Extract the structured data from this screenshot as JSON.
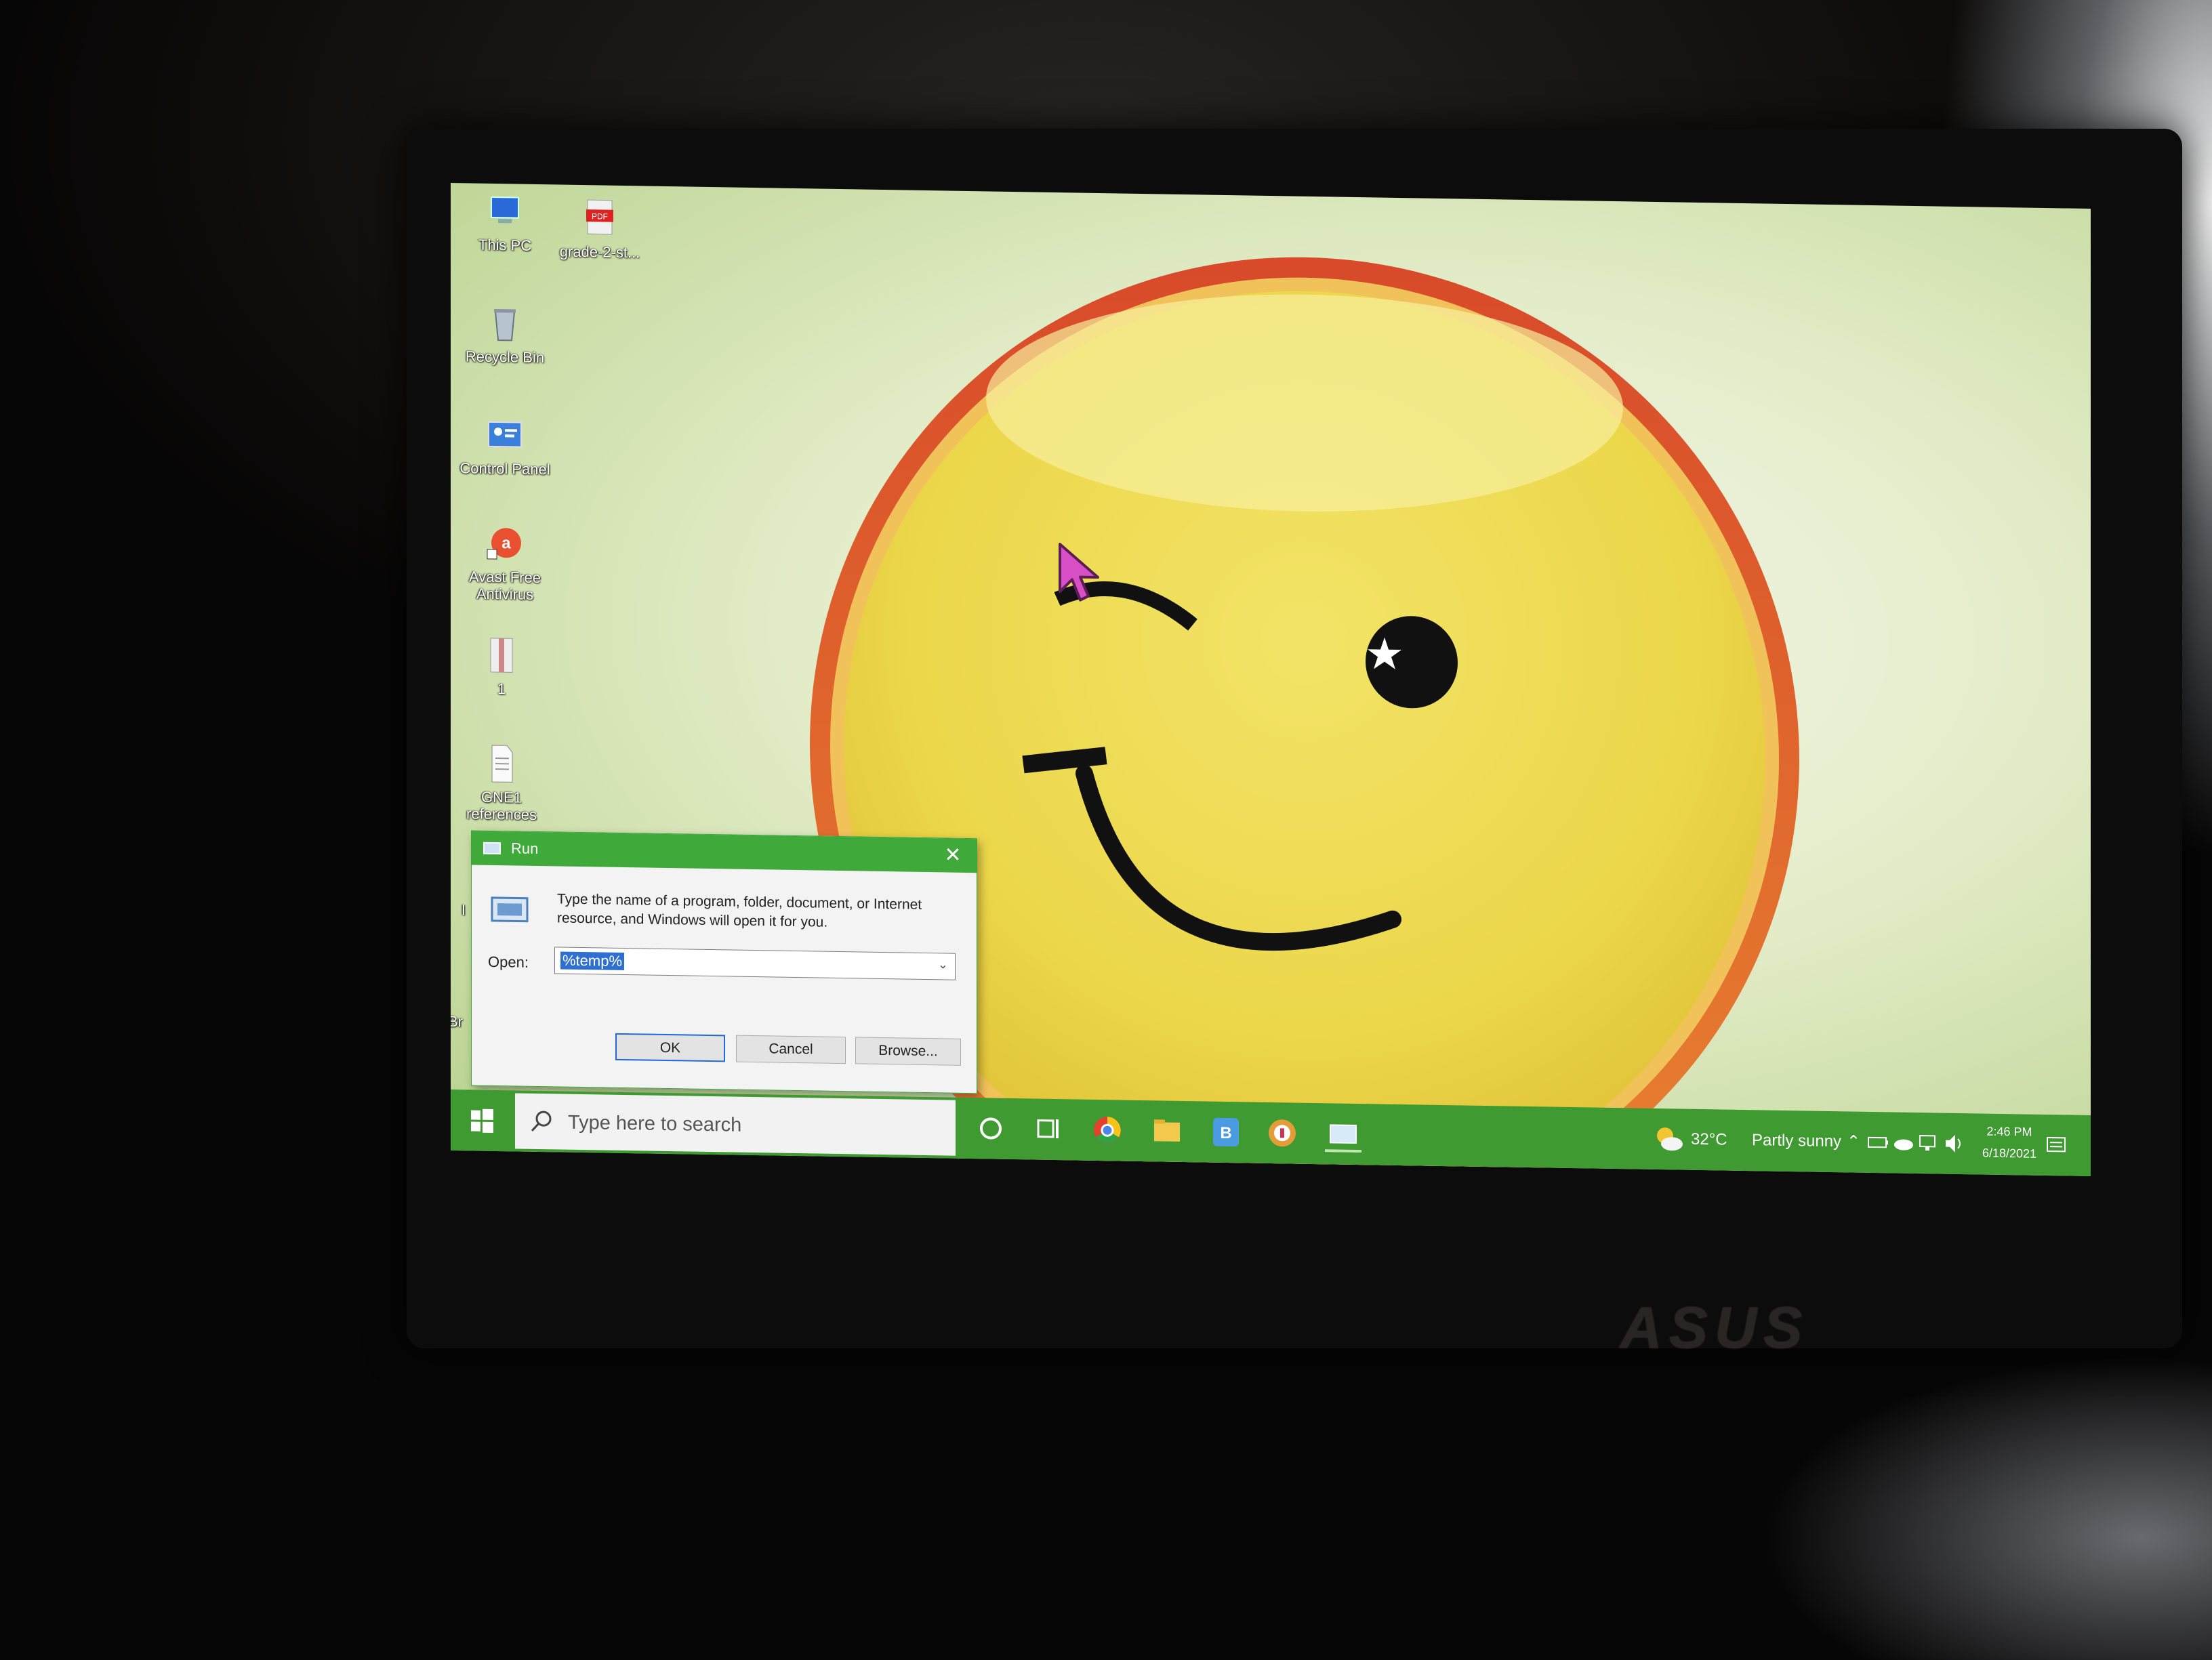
{
  "desktop": {
    "icons": [
      {
        "label": "This PC",
        "icon": "computer-icon"
      },
      {
        "label": "grade-2-st...",
        "icon": "pdf-icon"
      },
      {
        "label": "Recycle Bin",
        "icon": "recycle-bin-icon"
      },
      {
        "label": "Control Panel",
        "icon": "control-panel-icon"
      },
      {
        "label": "Avast Free Antivirus",
        "icon": "avast-icon"
      },
      {
        "label": "1",
        "icon": "archive-icon"
      },
      {
        "label": "GNE1 references",
        "icon": "document-icon"
      }
    ],
    "partial_labels": [
      "I",
      "Br"
    ]
  },
  "run_dialog": {
    "title": "Run",
    "close_glyph": "✕",
    "description": "Type the name of a program, folder, document, or Internet resource, and Windows will open it for you.",
    "open_label": "Open:",
    "open_value": "%temp%",
    "ok_label": "OK",
    "cancel_label": "Cancel",
    "browse_label": "Browse..."
  },
  "taskbar": {
    "search_placeholder": "Type here to search",
    "apps": [
      "cortana-icon",
      "task-view-icon",
      "chrome-icon",
      "file-explorer-icon",
      "bitcoin-app-icon",
      "vpn-app-icon",
      "run-icon"
    ],
    "weather": {
      "temp": "32°C",
      "condition": "Partly sunny"
    },
    "clock": {
      "time": "2:46 PM",
      "date": "6/18/2021"
    }
  },
  "monitor": {
    "brand": "ASUS"
  },
  "colors": {
    "taskbar": "#3f9a31",
    "accent": "#3fa93a",
    "selection": "#2f6fd0",
    "cursor": "#d94fc6"
  }
}
